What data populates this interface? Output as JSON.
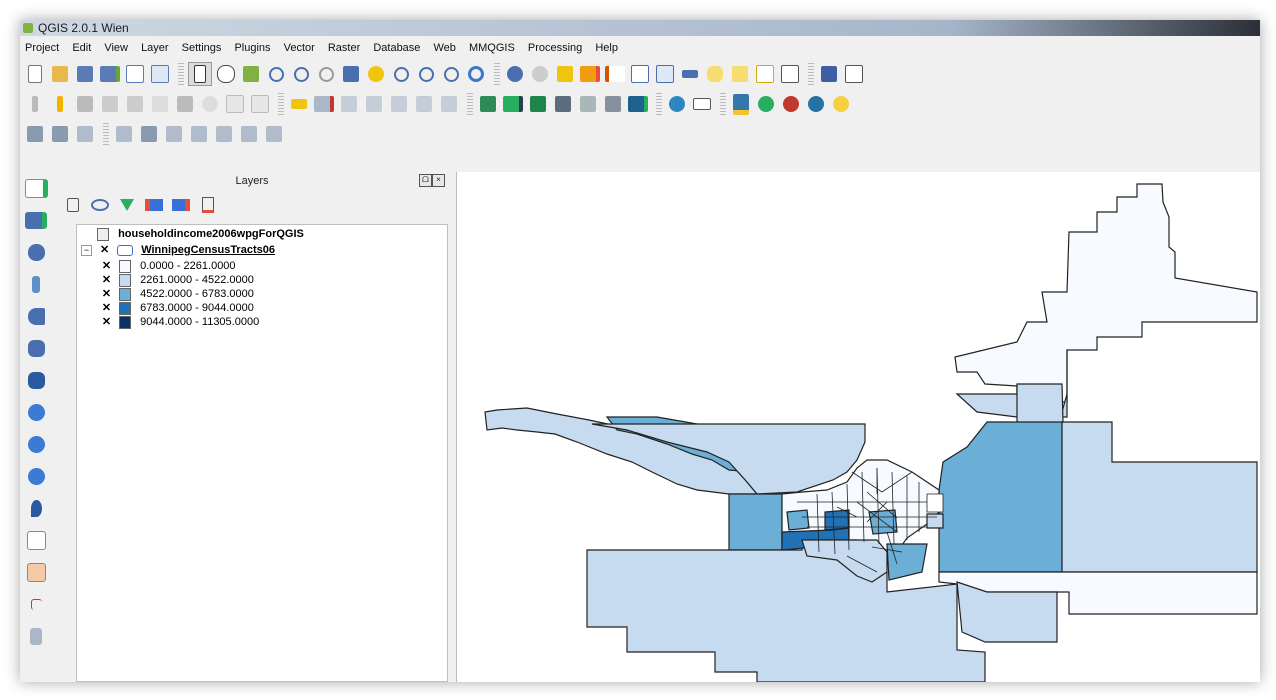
{
  "window": {
    "title": "QGIS 2.0.1 Wien"
  },
  "menu": [
    "Project",
    "Edit",
    "View",
    "Layer",
    "Settings",
    "Plugins",
    "Vector",
    "Raster",
    "Database",
    "Web",
    "MMQGIS",
    "Processing",
    "Help"
  ],
  "layers_panel": {
    "title": "Layers",
    "float_label": "ᗝ",
    "close_label": "×",
    "layers": [
      {
        "name": "householdincome2006wpgForQGIS",
        "type": "table"
      },
      {
        "name": "WinnipegCensusTracts06",
        "type": "polygon",
        "checked": "✕",
        "classes": [
          {
            "label": "0.0000 - 2261.0000",
            "color": "#f7fbff"
          },
          {
            "label": "2261.0000 - 4522.0000",
            "color": "#c6dbef"
          },
          {
            "label": "4522.0000 - 6783.0000",
            "color": "#6baed6"
          },
          {
            "label": "6783.0000 - 9044.0000",
            "color": "#2171b5"
          },
          {
            "label": "9044.0000 - 11305.0000",
            "color": "#08306b"
          }
        ]
      }
    ]
  },
  "class_checked": "✕",
  "colors": {
    "water": "#ffffff",
    "outline": "#222222"
  }
}
